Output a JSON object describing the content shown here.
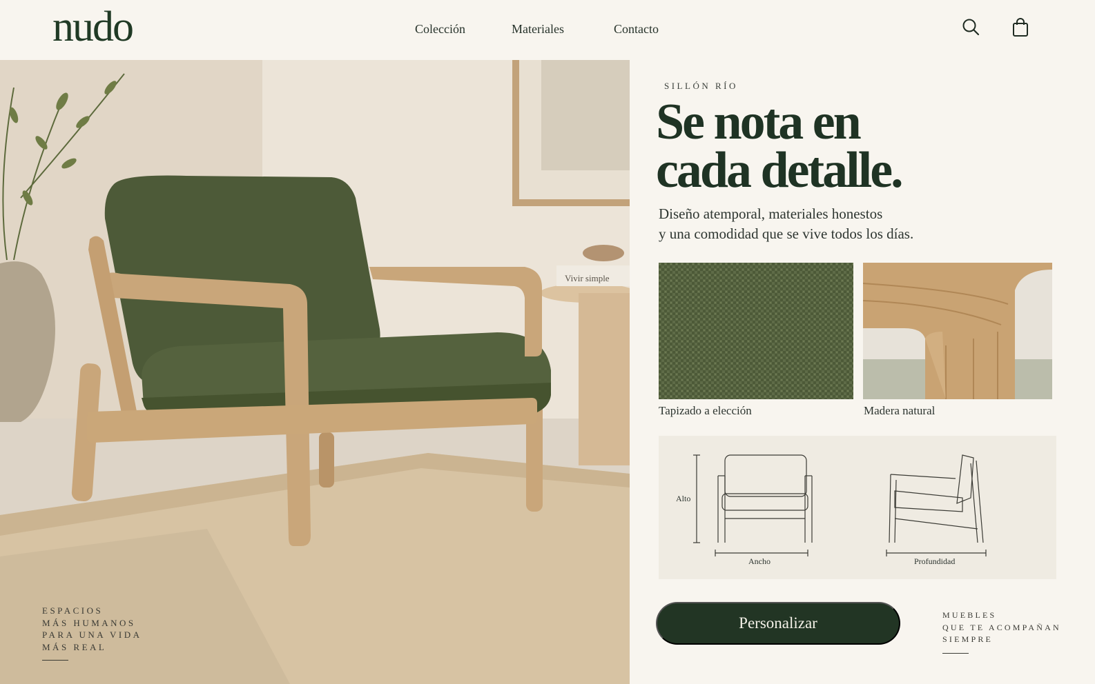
{
  "brand": {
    "logo": "nudo"
  },
  "nav": {
    "items": [
      "Colección",
      "Materiales",
      "Contacto"
    ]
  },
  "header_icons": {
    "search": "search-icon",
    "cart": "shopping-bag-icon"
  },
  "hero": {
    "book_title": "Vivir simple",
    "tagline_lines": [
      "ESPACIOS",
      "MÁS HUMANOS",
      "PARA UNA VIDA",
      "MÁS REAL"
    ]
  },
  "product": {
    "eyebrow": "SILLÓN RÍO",
    "headline_lines": [
      "Se nota en",
      "cada detalle."
    ],
    "subline_lines": [
      "Diseño atemporal, materiales honestos",
      "y una comodidad que se vive todos los días."
    ],
    "materials": [
      {
        "label": "Tapizado a elección"
      },
      {
        "label": "Madera natural"
      }
    ],
    "dimensions": {
      "height": "Alto",
      "width": "Ancho",
      "depth": "Profundidad"
    },
    "cta_label": "Personalizar",
    "side_tag_lines": [
      "MUEBLES",
      "QUE TE ACOMPAÑAN",
      "SIEMPRE"
    ]
  },
  "colors": {
    "background": "#f8f5ef",
    "brand_green": "#223524",
    "upholstery": "#4d5a38",
    "wood": "#c9a67a"
  }
}
